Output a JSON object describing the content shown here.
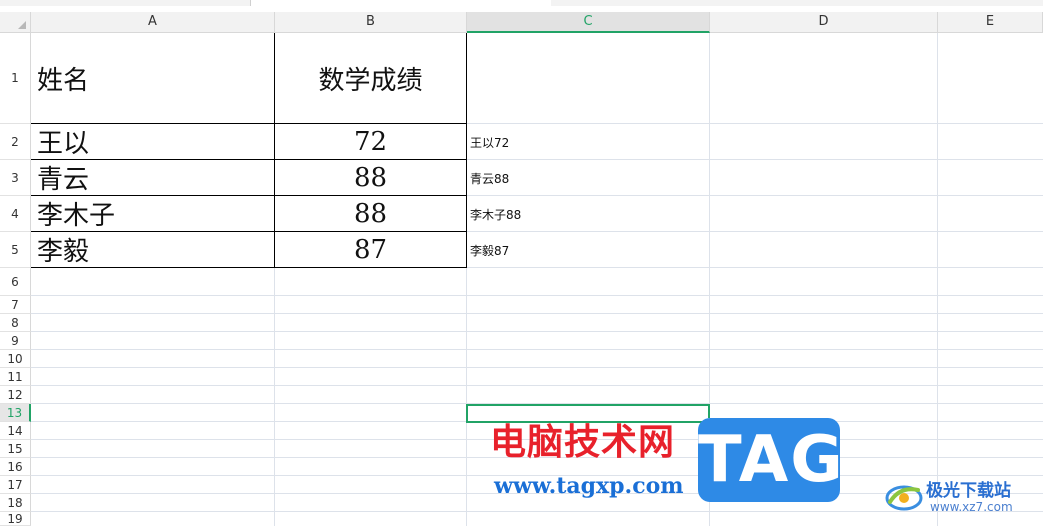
{
  "columns": [
    "A",
    "B",
    "C",
    "D",
    "E"
  ],
  "selected_column": "C",
  "rows": [
    "1",
    "2",
    "3",
    "4",
    "5",
    "6",
    "7",
    "8",
    "9",
    "10",
    "11",
    "12",
    "13",
    "14",
    "15",
    "16",
    "17",
    "18",
    "19"
  ],
  "selected_row": "13",
  "table": {
    "header": {
      "name": "姓名",
      "score": "数学成绩"
    },
    "records": [
      {
        "name": "王以",
        "score": "72",
        "combined": "王以72"
      },
      {
        "name": "青云",
        "score": "88",
        "combined": "青云88"
      },
      {
        "name": "李木子",
        "score": "88",
        "combined": "李木子88"
      },
      {
        "name": "李毅",
        "score": "87",
        "combined": "李毅87"
      }
    ]
  },
  "selection": {
    "cell": "C13",
    "color": "#21a366"
  },
  "watermark": {
    "title": "电脑技术网",
    "url": "www.tagxp.com",
    "tag": "TAG",
    "logo_name": "极光下载站",
    "logo_site": "www.xz7.com"
  }
}
